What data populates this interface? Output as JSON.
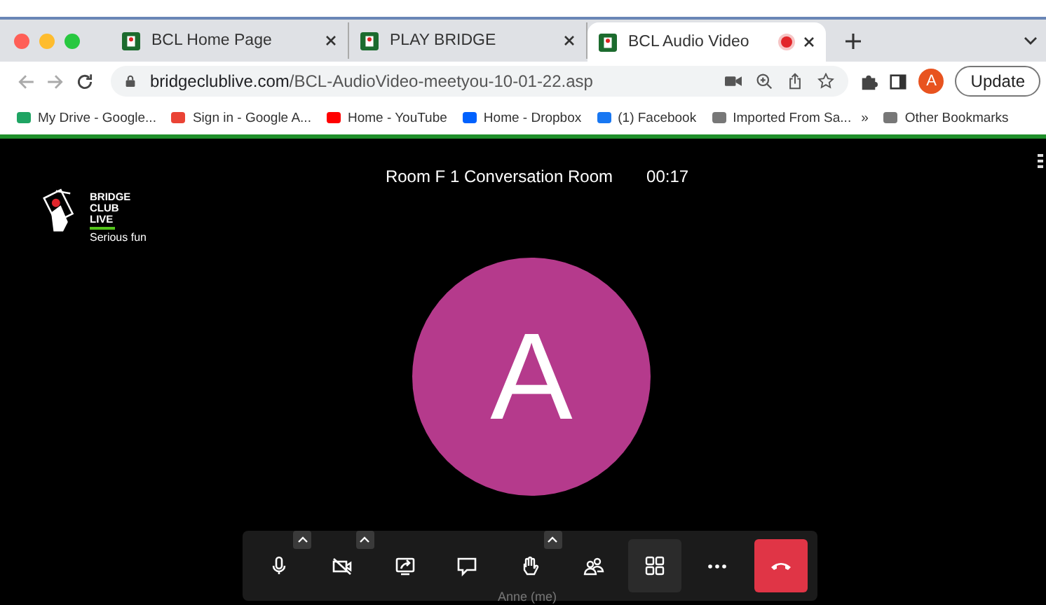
{
  "tabs": [
    {
      "label": "BCL Home Page",
      "selected": false,
      "recording": false
    },
    {
      "label": "PLAY BRIDGE",
      "selected": false,
      "recording": false
    },
    {
      "label": "BCL Audio Video",
      "selected": true,
      "recording": true
    }
  ],
  "address": {
    "host": "bridgeclublive.com",
    "path": "/BCL-AudioVideo-meetyou-10-01-22.asp"
  },
  "profile_initial": "A",
  "update_label": "Update",
  "bookmarks": [
    {
      "label": "My Drive - Google...",
      "kind": "drive"
    },
    {
      "label": "Sign in - Google A...",
      "kind": "gmail"
    },
    {
      "label": "Home - YouTube",
      "kind": "youtube"
    },
    {
      "label": "Home - Dropbox",
      "kind": "dropbox"
    },
    {
      "label": "(1) Facebook",
      "kind": "facebook"
    },
    {
      "label": "Imported From Sa...",
      "kind": "folder"
    }
  ],
  "bookmarks_more": "»",
  "other_bookmarks": "Other Bookmarks",
  "logo": {
    "lines": [
      "BRIDGE",
      "CLUB",
      "LIVE"
    ],
    "tagline": "Serious fun"
  },
  "room_title": "Room F 1 Conversation Room",
  "timer": "00:17",
  "avatar_initial": "A",
  "participant_name": "Anne (me)",
  "toolbar": [
    {
      "kind": "mic",
      "menu": true,
      "selected": false
    },
    {
      "kind": "camera-off",
      "menu": true,
      "selected": false
    },
    {
      "kind": "share",
      "menu": false,
      "selected": false
    },
    {
      "kind": "chat",
      "menu": false,
      "selected": false
    },
    {
      "kind": "hand",
      "menu": true,
      "selected": false
    },
    {
      "kind": "participants",
      "menu": false,
      "selected": false
    },
    {
      "kind": "grid",
      "menu": false,
      "selected": true
    },
    {
      "kind": "more",
      "menu": false,
      "selected": false
    },
    {
      "kind": "hangup",
      "menu": false,
      "selected": false
    }
  ]
}
